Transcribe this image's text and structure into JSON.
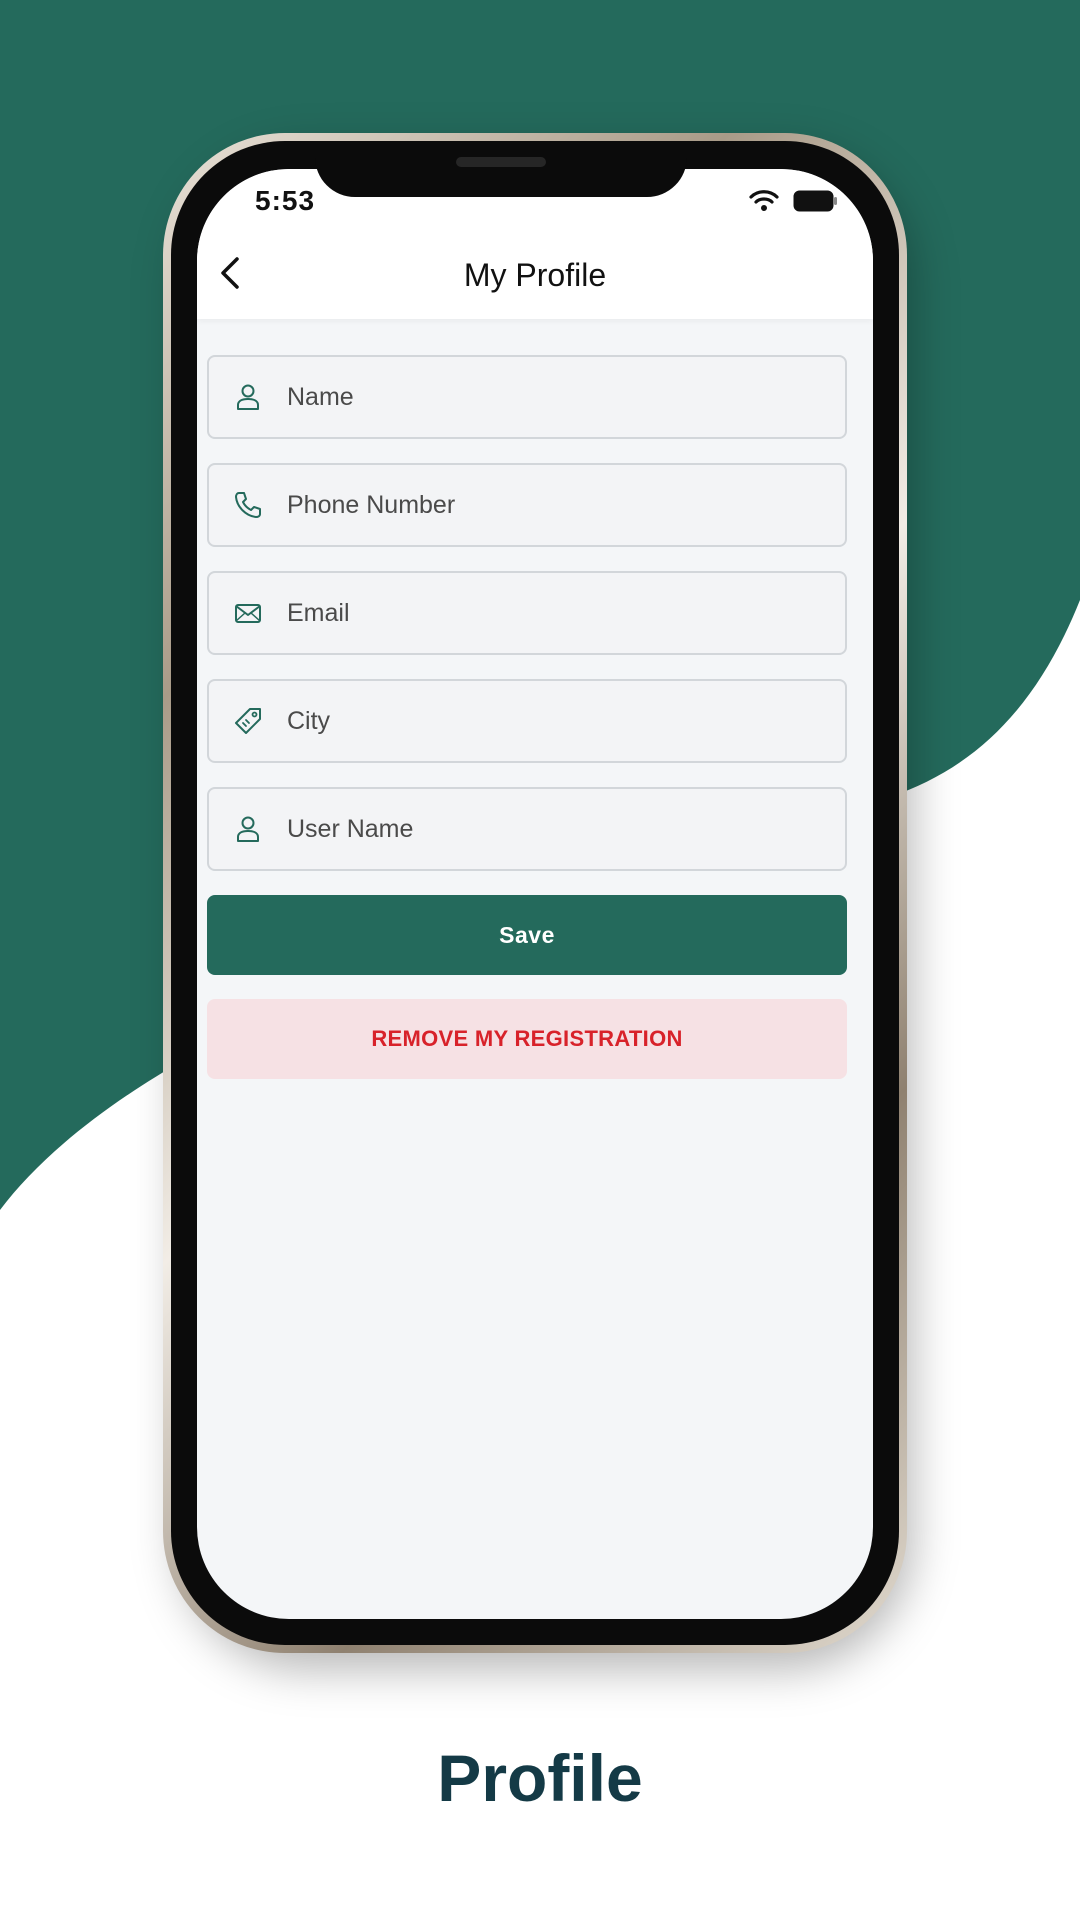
{
  "colors": {
    "brand_green": "#246a5c",
    "danger_red": "#d8222a",
    "danger_bg": "#f6e1e4",
    "caption_color": "#143a46"
  },
  "status_bar": {
    "time": "5:53",
    "icons": [
      "wifi-icon",
      "battery-icon"
    ]
  },
  "header": {
    "title": "My Profile",
    "back_icon": "chevron-left-icon"
  },
  "form": {
    "fields": [
      {
        "icon": "user-icon",
        "placeholder": "Name",
        "value": ""
      },
      {
        "icon": "phone-icon",
        "placeholder": "Phone Number",
        "value": ""
      },
      {
        "icon": "mail-icon",
        "placeholder": "Email",
        "value": ""
      },
      {
        "icon": "tag-icon",
        "placeholder": "City",
        "value": ""
      },
      {
        "icon": "user-icon",
        "placeholder": "User Name",
        "value": ""
      }
    ],
    "save_label": "Save",
    "remove_label": "REMOVE MY REGISTRATION"
  },
  "caption": "Profile"
}
